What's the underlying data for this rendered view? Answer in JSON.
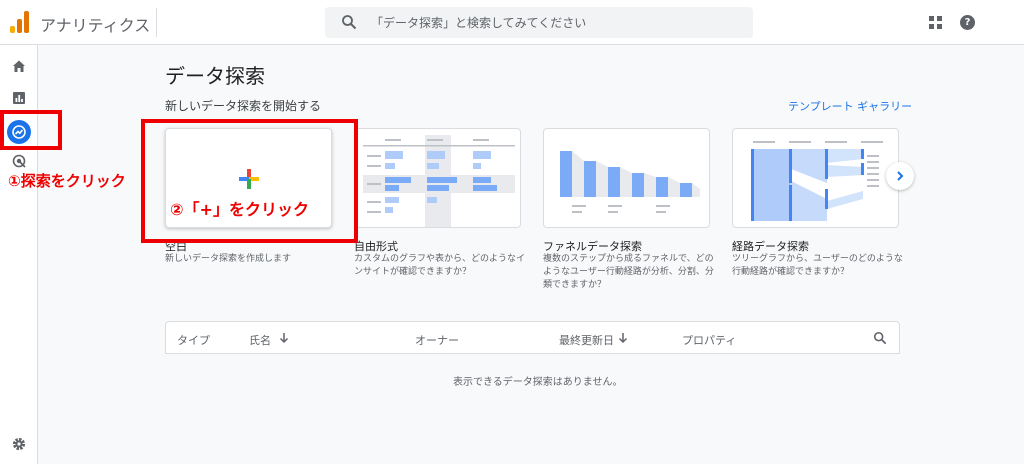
{
  "header": {
    "app_title": "アナリティクス",
    "search_placeholder": "「データ探索」と検索してみてください"
  },
  "main": {
    "page_title": "データ探索",
    "section_label": "新しいデータ探索を開始する",
    "gallery_link": "テンプレート ギャラリー",
    "templates": [
      {
        "title": "空白",
        "desc": "新しいデータ探索を作成します"
      },
      {
        "title": "自由形式",
        "desc": "カスタムのグラフや表から、どのようなインサイトが確認できますか？"
      },
      {
        "title": "ファネルデータ探索",
        "desc": "複数のステップから成るファネルで、どのようなユーザー行動経路が分析、分割、分類できますか？"
      },
      {
        "title": "経路データ探索",
        "desc": "ツリーグラフから、ユーザーのどのような行動経路が確認できますか？"
      }
    ]
  },
  "table": {
    "columns": [
      "タイプ",
      "氏名",
      "オーナー",
      "最終更新日",
      "プロパティ"
    ],
    "empty_message": "表示できるデータ探索はありません。"
  },
  "annotations": {
    "step1": "①探索をクリック",
    "step2": "②「+」をクリック"
  },
  "icons": {
    "rail": [
      "home-icon",
      "reports-icon",
      "explore-icon",
      "advertising-icon",
      "settings-icon"
    ],
    "header": [
      "search-icon",
      "apps-icon",
      "help-icon"
    ]
  },
  "colors": {
    "accent": "#1a73e8",
    "annotation": "#ee0000",
    "logo": "#f9ab00"
  }
}
